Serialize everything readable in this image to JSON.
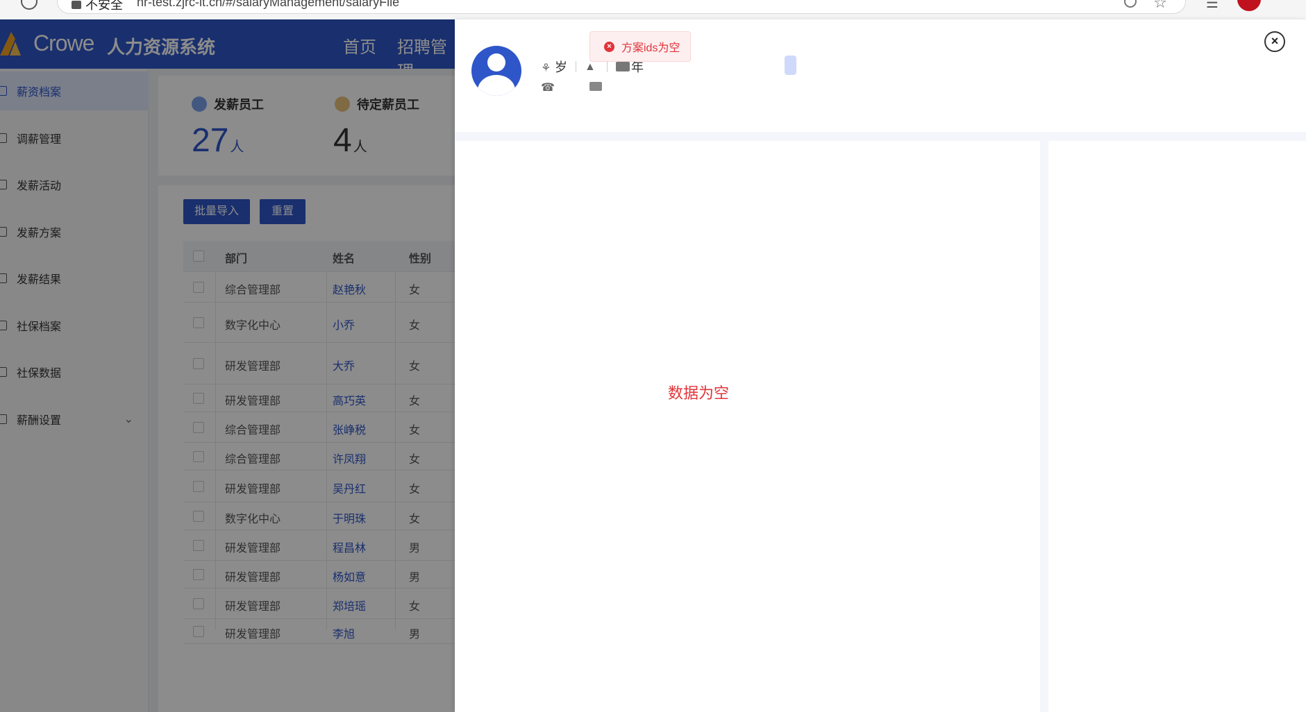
{
  "browser": {
    "insecure_label": "不安全",
    "url": "hr-test.zjrc-it.cn/#/salaryManagement/salaryFile"
  },
  "header": {
    "logo_text": "Crowe",
    "system_name": "人力资源系统",
    "nav": [
      "首页",
      "招聘管理"
    ]
  },
  "sidebar": {
    "items": [
      {
        "label": "薪资档案",
        "active": true
      },
      {
        "label": "调薪管理"
      },
      {
        "label": "发薪活动"
      },
      {
        "label": "发薪方案"
      },
      {
        "label": "发薪结果"
      },
      {
        "label": "社保档案"
      },
      {
        "label": "社保数据"
      },
      {
        "label": "薪酬设置",
        "expandable": true
      }
    ]
  },
  "stats": [
    {
      "label": "发薪员工",
      "value": "27",
      "unit": "人"
    },
    {
      "label": "待定薪员工",
      "value": "4",
      "unit": "人"
    }
  ],
  "toolbar": {
    "import_label": "批量导入",
    "reset_label": "重置"
  },
  "table": {
    "headers": {
      "dept": "部门",
      "name": "姓名",
      "gender": "性别"
    },
    "rows": [
      {
        "dept": "综合管理部",
        "name": "赵艳秋",
        "gender": "女"
      },
      {
        "dept": "数字化中心",
        "name": "小乔",
        "gender": "女"
      },
      {
        "dept": "研发管理部",
        "name": "大乔",
        "gender": "女"
      },
      {
        "dept": "研发管理部",
        "name": "高巧英",
        "gender": "女"
      },
      {
        "dept": "综合管理部",
        "name": "张峥税",
        "gender": "女"
      },
      {
        "dept": "综合管理部",
        "name": "许凤翔",
        "gender": "女"
      },
      {
        "dept": "研发管理部",
        "name": "吴丹红",
        "gender": "女"
      },
      {
        "dept": "数字化中心",
        "name": "于明珠",
        "gender": "女"
      },
      {
        "dept": "研发管理部",
        "name": "程昌林",
        "gender": "男"
      },
      {
        "dept": "研发管理部",
        "name": "杨如意",
        "gender": "男"
      },
      {
        "dept": "研发管理部",
        "name": "郑培瑶",
        "gender": "女"
      },
      {
        "dept": "研发管理部",
        "name": "李旭",
        "gender": "男"
      }
    ]
  },
  "drawer": {
    "age_unit": "岁",
    "year_unit": "年",
    "close_symbol": "×",
    "empty_text": "数据为空"
  },
  "toast": {
    "message": "方案ids为空",
    "type": "error",
    "icon": "×"
  }
}
